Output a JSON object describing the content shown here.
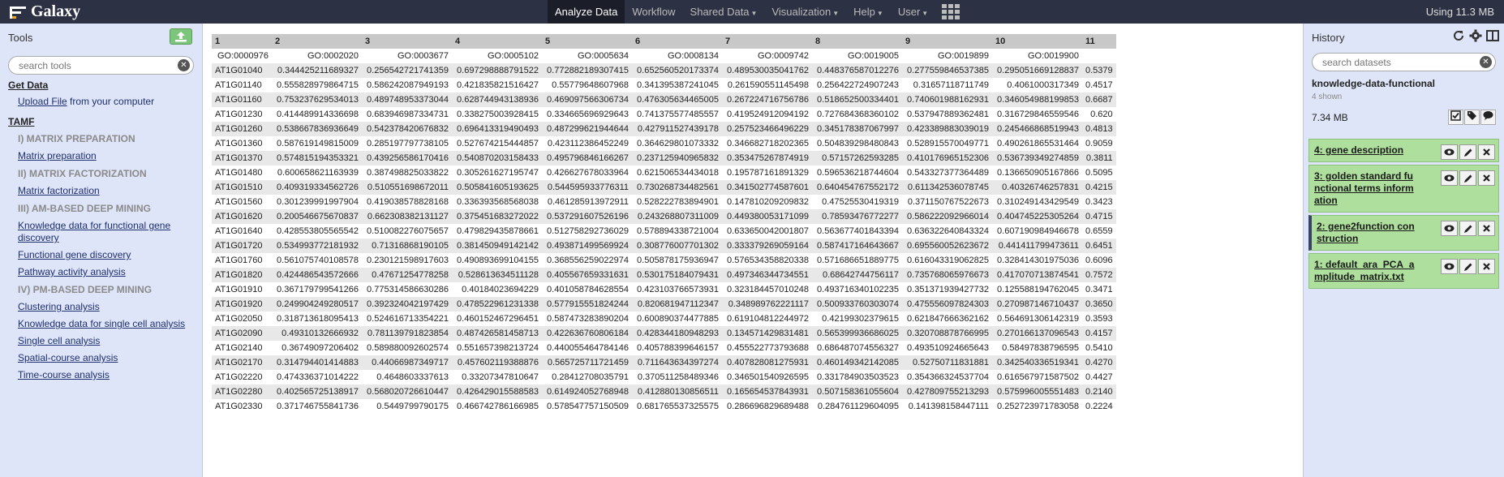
{
  "masthead": {
    "brand": "Galaxy",
    "nav": [
      {
        "label": "Analyze Data",
        "active": true,
        "caret": false
      },
      {
        "label": "Workflow",
        "active": false,
        "caret": false
      },
      {
        "label": "Shared Data",
        "active": false,
        "caret": true
      },
      {
        "label": "Visualization",
        "active": false,
        "caret": true
      },
      {
        "label": "Help",
        "active": false,
        "caret": true
      },
      {
        "label": "User",
        "active": false,
        "caret": true
      }
    ],
    "usage": "Using 11.3 MB",
    "colors": {
      "bar": "#2c3143",
      "active": "#1b1e28"
    }
  },
  "tools": {
    "title": "Tools",
    "search_placeholder": "search tools",
    "get_data": {
      "label": "Get Data",
      "upload_link": "Upload File",
      "upload_suffix": " from your computer"
    },
    "tamf": {
      "label": "TAMF",
      "items": [
        {
          "type": "label",
          "text": "I) MATRIX PREPARATION"
        },
        {
          "type": "link",
          "text": "Matrix preparation"
        },
        {
          "type": "label",
          "text": "II) MATRIX FACTORIZATION"
        },
        {
          "type": "link",
          "text": "Matrix factorization"
        },
        {
          "type": "label",
          "text": "III) AM-BASED DEEP MINING"
        },
        {
          "type": "link",
          "text": "Knowledge data for functional gene discovery"
        },
        {
          "type": "link",
          "text": "Functional gene discovery"
        },
        {
          "type": "link",
          "text": "Pathway activity analysis"
        },
        {
          "type": "label",
          "text": "IV) PM-BASED DEEP MINING"
        },
        {
          "type": "link",
          "text": "Clustering analysis"
        },
        {
          "type": "link",
          "text": "Knowledge data for single cell analysis"
        },
        {
          "type": "link",
          "text": "Single cell analysis"
        },
        {
          "type": "link",
          "text": "Spatial-course analysis"
        },
        {
          "type": "link",
          "text": "Time-course analysis"
        }
      ]
    }
  },
  "table": {
    "col_numbers": [
      "1",
      "2",
      "3",
      "4",
      "5",
      "6",
      "7",
      "8",
      "9",
      "10",
      "11"
    ],
    "go_labels": [
      "GO:0000976",
      "GO:0002020",
      "GO:0003677",
      "GO:0005102",
      "GO:0005634",
      "GO:0008134",
      "GO:0009742",
      "GO:0019005",
      "GO:0019899",
      "GO:0019900",
      ""
    ],
    "rows": [
      [
        "AT1G01040",
        "0.344425211689327",
        "0.256542721741359",
        "0.697298888791522",
        "0.772882189307415",
        "0.652560520173374",
        "0.489530035041762",
        "0.448376587012276",
        "0.277559846537385",
        "0.295051669128837",
        "0.5379"
      ],
      [
        "AT1G01140",
        "0.555828979864715",
        "0.586242087949193",
        "0.421835821516427",
        "0.55779648607968",
        "0.341395387241045",
        "0.261590551145498",
        "0.256422724907243",
        "0.31657118711749",
        "0.4061000317349",
        "0.4517"
      ],
      [
        "AT1G01160",
        "0.753237629534013",
        "0.489748953373044",
        "0.628744943138936",
        "0.469097566306734",
        "0.476305634465005",
        "0.267224716756786",
        "0.518652500334401",
        "0.740601988162931",
        "0.346054988199853",
        "0.6687"
      ],
      [
        "AT1G01230",
        "0.414489914336698",
        "0.683946987334731",
        "0.338275003928415",
        "0.334665696929643",
        "0.741375577485557",
        "0.419524912094192",
        "0.727684368360102",
        "0.537947889362481",
        "0.316729846559546",
        "0.620"
      ],
      [
        "AT1G01260",
        "0.538667836936649",
        "0.542378420676832",
        "0.696413319490493",
        "0.487299621944644",
        "0.427911527439178",
        "0.257523466496229",
        "0.345178387067997",
        "0.423389883039019",
        "0.245466868519943",
        "0.4813"
      ],
      [
        "AT1G01360",
        "0.587619149815009",
        "0.285197797738105",
        "0.527674215444857",
        "0.423112386452249",
        "0.364629801073332",
        "0.346682718202365",
        "0.504839298480843",
        "0.528915570049771",
        "0.490261865531464",
        "0.9059"
      ],
      [
        "AT1G01370",
        "0.574815194353321",
        "0.439256586170416",
        "0.540870203158433",
        "0.495796846166267",
        "0.237125940965832",
        "0.353475267874919",
        "0.57157262593285",
        "0.410176965152306",
        "0.536739349274859",
        "0.3811"
      ],
      [
        "AT1G01480",
        "0.600658621163939",
        "0.387498825033822",
        "0.305261627195747",
        "0.426627678033964",
        "0.621506534434018",
        "0.195787161891329",
        "0.596536218744604",
        "0.543327377364489",
        "0.136650905167866",
        "0.5095"
      ],
      [
        "AT1G01510",
        "0.409319334562726",
        "0.510551698672011",
        "0.505841605193625",
        "0.544595933776311",
        "0.730268734482561",
        "0.341502774587601",
        "0.640454767552172",
        "0.611342536078745",
        "0.40326746257831",
        "0.4215"
      ],
      [
        "AT1G01560",
        "0.301239991997904",
        "0.419038578828168",
        "0.336393568568038",
        "0.461285913972911",
        "0.528222783894901",
        "0.147810209209832",
        "0.47525530419319",
        "0.371150767522673",
        "0.310249143429549",
        "0.3423"
      ],
      [
        "AT1G01620",
        "0.200546675670837",
        "0.662308382131127",
        "0.375451683272022",
        "0.537291607526196",
        "0.243268807311009",
        "0.449380053171099",
        "0.78593476772277",
        "0.586222092966014",
        "0.404745225305264",
        "0.4715"
      ],
      [
        "AT1G01640",
        "0.428553805565542",
        "0.510082276075657",
        "0.479829435878661",
        "0.512758292736029",
        "0.578894338721004",
        "0.633650042001807",
        "0.563677401843394",
        "0.636322640843324",
        "0.607190984946678",
        "0.6559"
      ],
      [
        "AT1G01720",
        "0.534993772181932",
        "0.71316868190105",
        "0.381450949142142",
        "0.493871499569924",
        "0.308776007701302",
        "0.333379269059164",
        "0.587417164643667",
        "0.695560052623672",
        "0.441411799473611",
        "0.6451"
      ],
      [
        "AT1G01760",
        "0.561075740108578",
        "0.230121598917603",
        "0.490893699104155",
        "0.368556259022974",
        "0.505878175936947",
        "0.576534358820338",
        "0.571686651889775",
        "0.616043319062825",
        "0.328414301975036",
        "0.6096"
      ],
      [
        "AT1G01820",
        "0.424486543572666",
        "0.47671254778258",
        "0.528613634511128",
        "0.405567659331631",
        "0.530175184079431",
        "0.497346344734551",
        "0.68642744756117",
        "0.735768065976673",
        "0.417070713874541",
        "0.7572"
      ],
      [
        "AT1G01910",
        "0.367179799541266",
        "0.775314586630286",
        "0.40184023694229",
        "0.401058784628554",
        "0.423103766573931",
        "0.323184457010248",
        "0.493716340102235",
        "0.351371939427732",
        "0.125588194762045",
        "0.3471"
      ],
      [
        "AT1G01920",
        "0.249904249280517",
        "0.392324042197429",
        "0.478522961231338",
        "0.577915551824244",
        "0.820681947112347",
        "0.348989762221117",
        "0.500933760303074",
        "0.475556097824303",
        "0.270987146710437",
        "0.3650"
      ],
      [
        "AT1G02050",
        "0.318713618095413",
        "0.524616713354221",
        "0.460152467296451",
        "0.587473283890204",
        "0.600890374477885",
        "0.619104812244972",
        "0.42199302379615",
        "0.621847666362162",
        "0.564691306142319",
        "0.3593"
      ],
      [
        "AT1G02090",
        "0.49310132666932",
        "0.781139791823854",
        "0.487426581458713",
        "0.422636760806184",
        "0.428344180948293",
        "0.134571429831481",
        "0.565399936686025",
        "0.320708878766995",
        "0.270166137096543",
        "0.4157"
      ],
      [
        "AT1G02140",
        "0.36749097206402",
        "0.589880092602574",
        "0.551657398213724",
        "0.440055464784146",
        "0.405788399646157",
        "0.455522773793688",
        "0.686487074556327",
        "0.493510924665643",
        "0.58497838796595",
        "0.5410"
      ],
      [
        "AT1G02170",
        "0.314794401414883",
        "0.44066987349717",
        "0.457602119388876",
        "0.565725711721459",
        "0.711643634397274",
        "0.407828081275931",
        "0.460149342142085",
        "0.52750711831881",
        "0.342540336519341",
        "0.4270"
      ],
      [
        "AT1G02220",
        "0.474336371014222",
        "0.4648603337613",
        "0.33207347810647",
        "0.28412708035791",
        "0.370511258489346",
        "0.346501540926595",
        "0.331784903503523",
        "0.354366324537704",
        "0.616567971587502",
        "0.4427"
      ],
      [
        "AT1G02280",
        "0.402565725138917",
        "0.568020726610447",
        "0.426429015588583",
        "0.614924052768948",
        "0.412880130856511",
        "0.165654537843931",
        "0.507158361055604",
        "0.427809755213293",
        "0.575996005551483",
        "0.2140"
      ],
      [
        "AT1G02330",
        "0.371746755841736",
        "0.5449799790175",
        "0.466742786166985",
        "0.578547757150509",
        "0.681765537325575",
        "0.286696829689488",
        "0.284761129604095",
        "0.141398158447111",
        "0.252723971783058",
        "0.2224"
      ]
    ]
  },
  "history": {
    "title": "History",
    "search_placeholder": "search datasets",
    "name": "knowledge-data-functional",
    "shown": "4 shown",
    "size": "7.34 MB",
    "datasets": [
      {
        "title": "4: gene description",
        "selected": false
      },
      {
        "title": "3: golden standard functional terms information",
        "selected": false
      },
      {
        "title": "2: gene2function construction",
        "selected": true
      },
      {
        "title": "1: default_ara_PCA_amplitude_matrix.txt",
        "selected": false
      }
    ],
    "colors": {
      "dataset_ok": "#aedf9c"
    }
  }
}
